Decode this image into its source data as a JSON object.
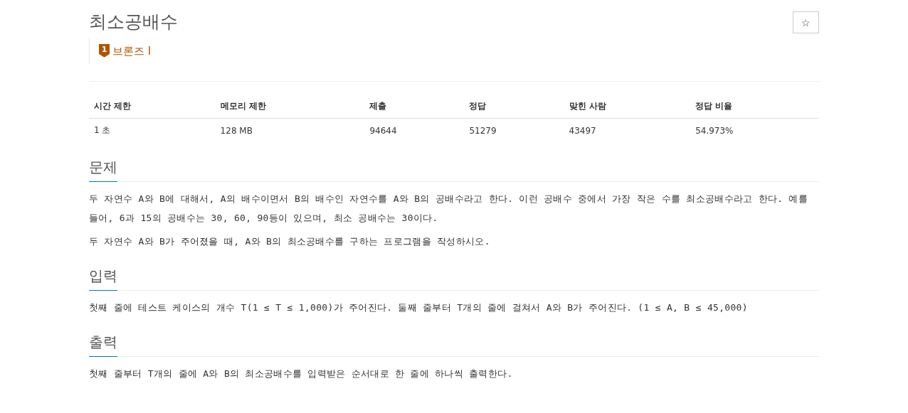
{
  "problem": {
    "title": "최소공배수",
    "star_button": "☆",
    "tier": {
      "number": "1",
      "label": "브론즈 I"
    }
  },
  "table": {
    "columns": [
      "시간 제한",
      "메모리 제한",
      "제출",
      "정답",
      "맞힌 사람",
      "정답 비율"
    ],
    "rows": [
      [
        "1 초",
        "128 MB",
        "94644",
        "51279",
        "43497",
        "54.973%"
      ]
    ]
  },
  "sections": [
    {
      "heading": "문제",
      "paragraphs": [
        "두 자연수 A와 B에 대해서, A의 배수이면서 B의 배수인 자연수를 A와 B의 공배수라고 한다. 이런 공배수 중에서 가장 작은 수를 최소공배수라고 한다. 예를 들어, 6과 15의 공배수는 30, 60, 90등이 있으며, 최소 공배수는 30이다.",
        "두 자연수 A와 B가 주어졌을 때, A와 B의 최소공배수를 구하는 프로그램을 작성하시오."
      ]
    },
    {
      "heading": "입력",
      "paragraphs": [
        "첫째 줄에 테스트 케이스의 개수 T(1 ≤ T ≤ 1,000)가 주어진다. 둘째 줄부터 T개의 줄에 걸쳐서 A와 B가 주어진다. (1 ≤ A, B ≤ 45,000)"
      ]
    },
    {
      "heading": "출력",
      "paragraphs": [
        "첫째 줄부터 T개의 줄에 A와 B의 최소공배수를 입력받은 순서대로 한 줄에 하나씩 출력한다."
      ]
    }
  ]
}
